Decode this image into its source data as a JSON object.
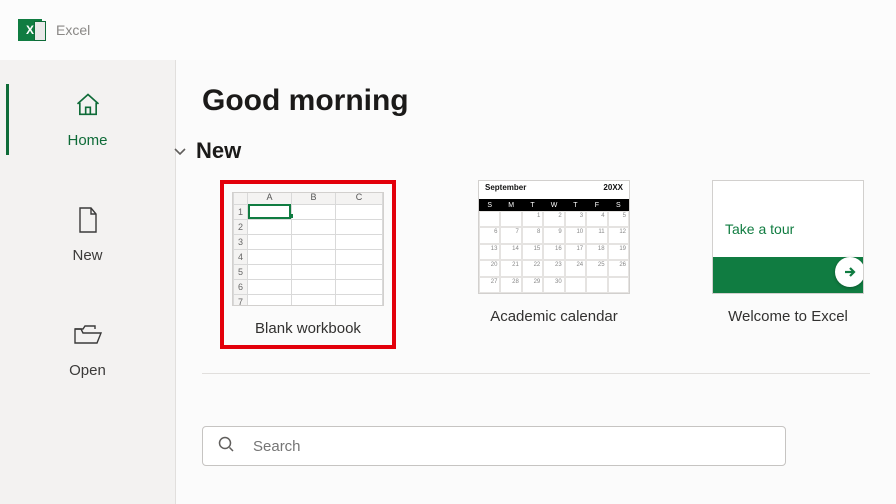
{
  "app": {
    "name": "Excel"
  },
  "sidebar": {
    "items": [
      {
        "label": "Home"
      },
      {
        "label": "New"
      },
      {
        "label": "Open"
      }
    ]
  },
  "content": {
    "greeting": "Good morning",
    "section_new": "New",
    "templates": [
      {
        "caption": "Blank workbook",
        "highlighted": true
      },
      {
        "caption": "Academic calendar"
      },
      {
        "caption": "Welcome to Excel",
        "tour_text": "Take a tour"
      }
    ],
    "calendar_thumb": {
      "month": "September",
      "year": "20XX"
    },
    "search": {
      "placeholder": "Search",
      "value": ""
    }
  }
}
